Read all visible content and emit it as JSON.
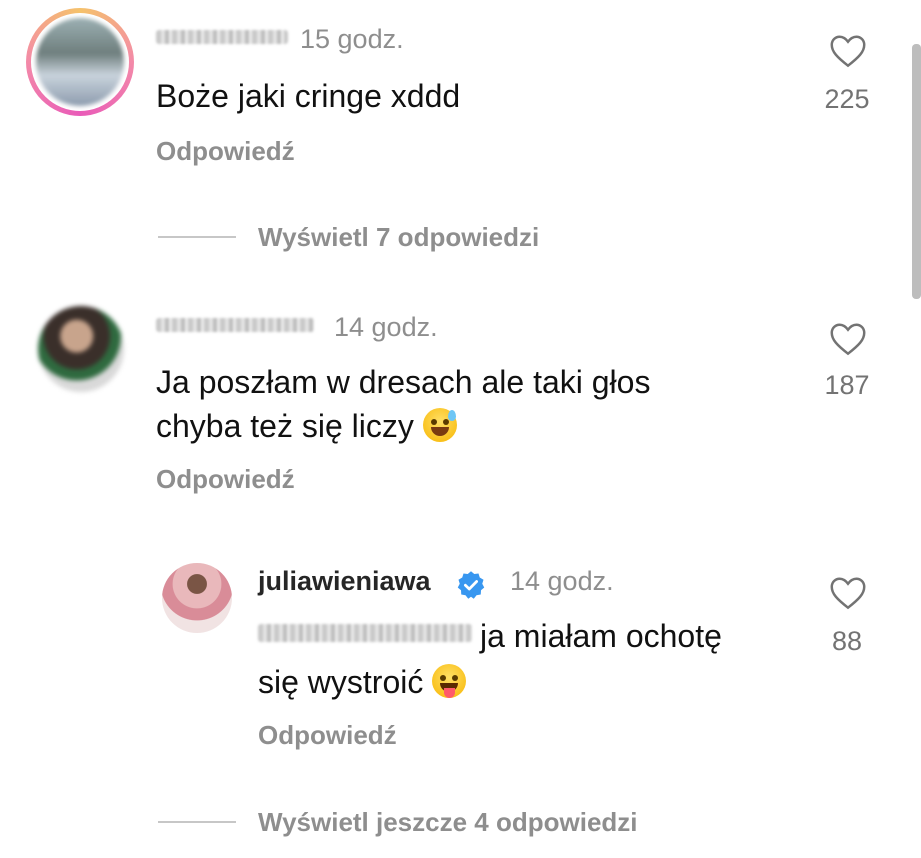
{
  "comments": [
    {
      "time": "15 godz.",
      "text": "Boże jaki cringe xddd",
      "reply_label": "Odpowiedź",
      "likes": "225",
      "view_replies": "Wyświetl 7 odpowiedzi"
    },
    {
      "time": "14 godz.",
      "text_line1": "Ja poszłam w dresach ale taki głos",
      "text_line2": "chyba też się liczy",
      "reply_label": "Odpowiedź",
      "likes": "187"
    },
    {
      "username": "juliawieniawa",
      "time": "14 godz.",
      "text_line1": "ja miałam ochotę",
      "text_line2": "się wystroić",
      "reply_label": "Odpowiedź",
      "likes": "88",
      "view_replies": "Wyświetl jeszcze 4 odpowiedzi"
    }
  ],
  "icons": {
    "heart": "heart-outline-icon",
    "verified": "verified-badge-icon",
    "emoji_sweat": "grinning-sweat-emoji",
    "emoji_tongue": "winking-tongue-emoji"
  },
  "colors": {
    "muted_text": "#8e8e8e",
    "verified_blue": "#3897f0",
    "story_ring": "#e95bb8"
  }
}
